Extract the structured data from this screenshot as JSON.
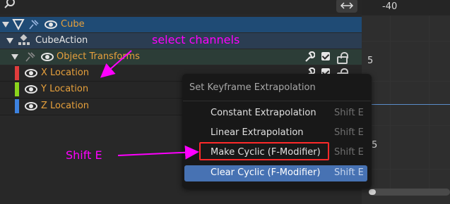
{
  "channels": {
    "rows": [
      {
        "label": "Cube",
        "color": "#e6a03c"
      },
      {
        "label": "CubeAction",
        "color": "#e6e6e6"
      },
      {
        "label": "Object Transforms",
        "color": "#e6a03c"
      }
    ],
    "fcurves": [
      {
        "label": "X Location",
        "color": "#e03c3c"
      },
      {
        "label": "Y Location",
        "color": "#8bd41c"
      },
      {
        "label": "Z Location",
        "color": "#3c82e0"
      }
    ]
  },
  "graph": {
    "ruler_label": "-40",
    "tick_labels": [
      "5",
      "5"
    ]
  },
  "menu": {
    "title": "Set Keyframe Extrapolation",
    "items": [
      {
        "label": "Constant Extrapolation",
        "shortcut": "Shift E",
        "highlighted": false
      },
      {
        "label": "Linear Extrapolation",
        "shortcut": "Shift E",
        "highlighted": false
      },
      {
        "label": "Make Cyclic (F-Modifier)",
        "shortcut": "Shift E",
        "highlighted": false
      },
      {
        "label": "Clear Cyclic (F-Modifier)",
        "shortcut": "Shift E",
        "highlighted": true
      }
    ]
  },
  "annotations": {
    "select_note": "select channels",
    "shortcut_note": "Shift E",
    "color": "#ff00ff",
    "box_color": "#ff2a2a"
  },
  "icons": [
    "search-icon",
    "swap-arrows-icon",
    "eye-icon",
    "pin-icon",
    "filter-icon",
    "action-icon",
    "wrench-icon",
    "checkbox-icon",
    "lock-icon"
  ]
}
